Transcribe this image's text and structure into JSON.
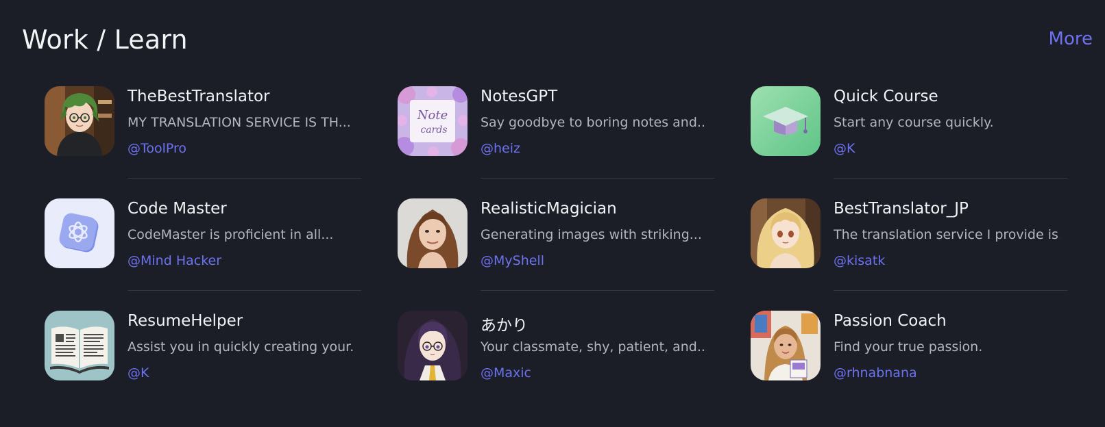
{
  "section": {
    "title": "Work / Learn",
    "more_label": "More"
  },
  "colors": {
    "background": "#1b1e27",
    "accent": "#6d72f0",
    "title": "#f1f2f5",
    "description": "#b3b6bf",
    "divider": "#323642"
  },
  "bots": [
    {
      "name": "TheBestTranslator",
      "description": "MY TRANSLATION SERVICE IS TH...",
      "author": "@ToolPro",
      "avatar_icon": "anime-boy-glasses-avatar"
    },
    {
      "name": "NotesGPT",
      "description": "Say goodbye to boring notes and...",
      "author": "@heiz",
      "avatar_icon": "floral-notecard-avatar"
    },
    {
      "name": "Quick Course",
      "description": "Start any course quickly.",
      "author": "@K",
      "avatar_icon": "graduation-cap-avatar"
    },
    {
      "name": "Code Master",
      "description": "CodeMaster is proficient in all...",
      "author": "@Mind Hacker",
      "avatar_icon": "openai-logo-avatar"
    },
    {
      "name": "RealisticMagician",
      "description": "Generating images with striking...",
      "author": "@MyShell",
      "avatar_icon": "woman-portrait-avatar"
    },
    {
      "name": "BestTranslator_JP",
      "description": "The translation service I provide is...",
      "author": "@kisatk",
      "avatar_icon": "anime-blonde-girl-avatar"
    },
    {
      "name": "ResumeHelper",
      "description": "Assist you in quickly creating your...",
      "author": "@K",
      "avatar_icon": "open-book-avatar"
    },
    {
      "name": "あかり",
      "description": "Your classmate, shy, patient, and...",
      "author": "@Maxic",
      "avatar_icon": "anime-girl-glasses-avatar"
    },
    {
      "name": "Passion Coach",
      "description": "Find your true passion.",
      "author": "@rhnabnana",
      "avatar_icon": "woman-with-book-avatar"
    }
  ]
}
